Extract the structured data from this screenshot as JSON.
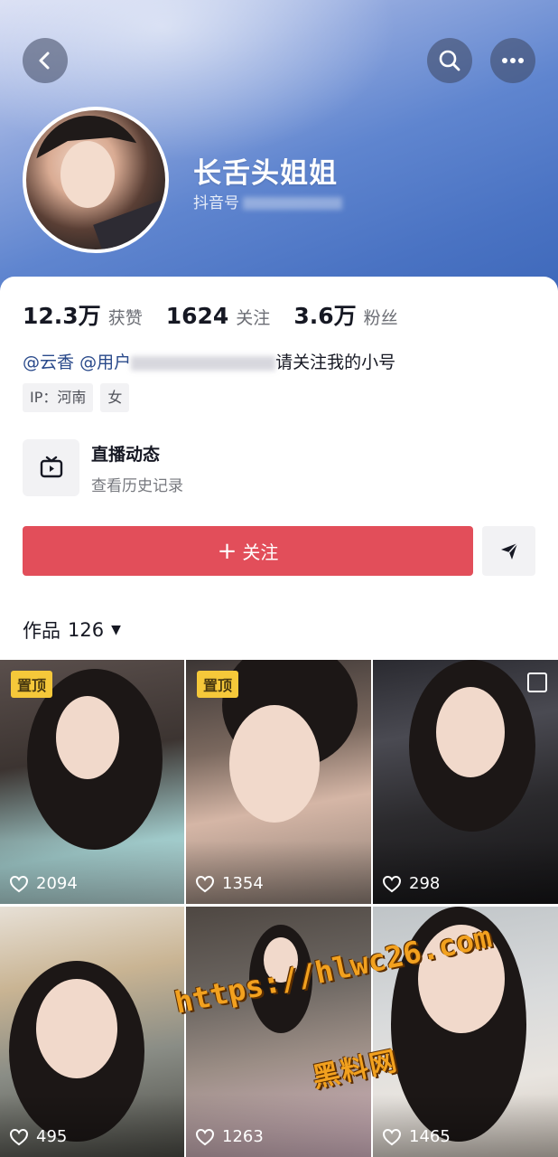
{
  "header": {
    "name": "长舌头姐姐",
    "douyin_id_label": "抖音号"
  },
  "stats": [
    {
      "value": "12.3万",
      "label": "获赞"
    },
    {
      "value": "1624",
      "label": "关注"
    },
    {
      "value": "3.6万",
      "label": "粉丝"
    }
  ],
  "bio": {
    "mention1": "@云香",
    "mention2": "@用户",
    "text_end": "请关注我的小号"
  },
  "tags": [
    "IP：河南",
    "女"
  ],
  "live": {
    "title": "直播动态",
    "subtitle": "查看历史记录",
    "icon": "tv-icon"
  },
  "actions": {
    "follow_label": "关注",
    "follow_color": "#e24e5a"
  },
  "works": {
    "label": "作品",
    "count": "126"
  },
  "grid": [
    {
      "pinned": "置顶",
      "likes": "2094"
    },
    {
      "pinned": "置顶",
      "likes": "1354"
    },
    {
      "likes": "298"
    },
    {
      "likes": "495"
    },
    {
      "likes": "1263"
    },
    {
      "likes": "1465"
    }
  ],
  "watermark": {
    "url": "https://hlwc26.com",
    "name": "黑料网"
  }
}
